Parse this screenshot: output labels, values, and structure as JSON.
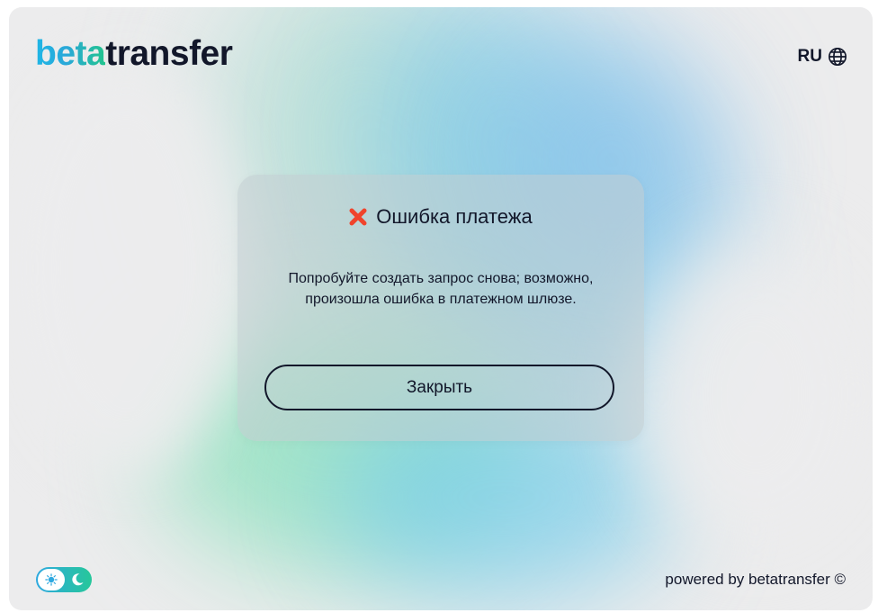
{
  "header": {
    "logo_part1": "beta",
    "logo_part2": "transfer",
    "language": "RU",
    "language_icon": "globe-icon"
  },
  "dialog": {
    "title": "Ошибка платежа",
    "title_icon": "error-x-icon",
    "message": "Попробуйте создать запрос снова; возможно, произошла ошибка в платежном шлюзе.",
    "close_label": "Закрыть"
  },
  "theme_toggle": {
    "icons": [
      "sun-icon",
      "moon-icon"
    ]
  },
  "footer": {
    "text": "powered by betatransfer ©"
  },
  "colors": {
    "accent_blue": "#2fa9e0",
    "accent_green": "#26c79a",
    "text": "#12172a",
    "error": "#f0442c"
  }
}
